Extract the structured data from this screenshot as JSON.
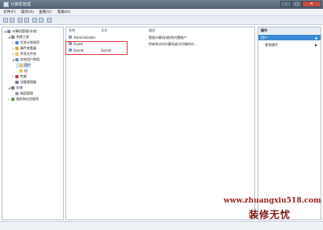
{
  "window": {
    "title": "计算机管理"
  },
  "menu": [
    "文件(F)",
    "操作(A)",
    "查看(V)",
    "帮助(H)"
  ],
  "tree": [
    {
      "label": "计算机管理(本地)",
      "indent": 0,
      "expanded": true,
      "icon": "computer-icon"
    },
    {
      "label": "系统工具",
      "indent": 1,
      "expanded": true,
      "icon": "tools-icon"
    },
    {
      "label": "任务计划程序",
      "indent": 2,
      "expanded": false,
      "icon": "clock-icon"
    },
    {
      "label": "事件查看器",
      "indent": 2,
      "expanded": false,
      "icon": "event-log-icon"
    },
    {
      "label": "共享文件夹",
      "indent": 2,
      "expanded": false,
      "icon": "folder-icon"
    },
    {
      "label": "本地用户和组",
      "indent": 2,
      "expanded": true,
      "icon": "users-icon"
    },
    {
      "label": "用户",
      "indent": 3,
      "expanded": null,
      "icon": "folder-icon",
      "selected": true
    },
    {
      "label": "组",
      "indent": 3,
      "expanded": null,
      "icon": "folder-icon"
    },
    {
      "label": "性能",
      "indent": 2,
      "expanded": false,
      "icon": "performance-icon"
    },
    {
      "label": "设备管理器",
      "indent": 2,
      "expanded": null,
      "icon": "device-icon"
    },
    {
      "label": "存储",
      "indent": 1,
      "expanded": true,
      "icon": "storage-icon"
    },
    {
      "label": "磁盘管理",
      "indent": 2,
      "expanded": null,
      "icon": "disk-icon"
    },
    {
      "label": "服务和应用程序",
      "indent": 1,
      "expanded": false,
      "icon": "services-icon"
    }
  ],
  "columns": {
    "name": "名称",
    "fullname": "全名",
    "description": "描述"
  },
  "users": [
    {
      "name": "Administrator",
      "fullname": "",
      "description": "管理计算机(域)的内置帐户"
    },
    {
      "name": "Guest",
      "fullname": "",
      "description": "供来宾访问计算机或访问域的内..."
    },
    {
      "name": "Secret",
      "fullname": "Secret",
      "description": ""
    }
  ],
  "actions": {
    "header": "操作",
    "selected": "用户",
    "more": "更多操作"
  },
  "watermark": {
    "url": "www.zhuangxiu518.com",
    "brand": "装修无忧"
  }
}
